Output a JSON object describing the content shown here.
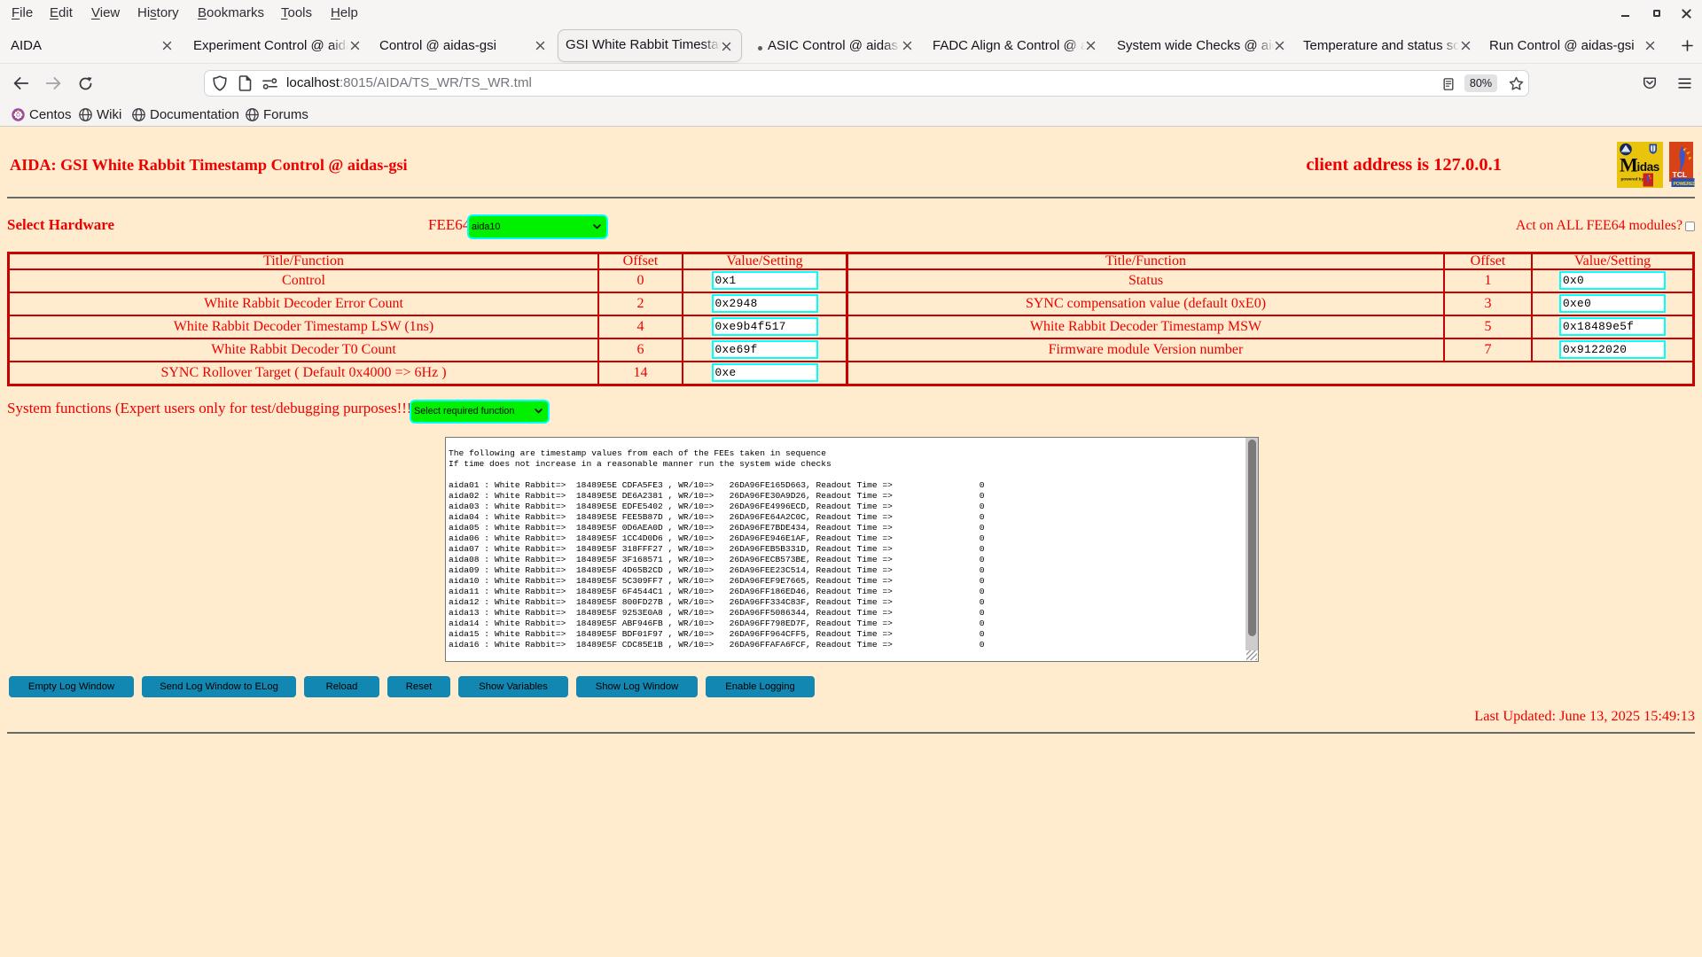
{
  "window": {
    "menus": [
      {
        "pre": "",
        "key": "F",
        "post": "ile"
      },
      {
        "pre": "",
        "key": "E",
        "post": "dit"
      },
      {
        "pre": "",
        "key": "V",
        "post": "iew"
      },
      {
        "pre": "Hi",
        "key": "s",
        "post": "tory"
      },
      {
        "pre": "",
        "key": "B",
        "post": "ookmarks"
      },
      {
        "pre": "",
        "key": "T",
        "post": "ools"
      },
      {
        "pre": "",
        "key": "H",
        "post": "elp"
      }
    ]
  },
  "tabs": [
    {
      "title": "AIDA",
      "active": false
    },
    {
      "title": "Experiment Control @ aidas",
      "active": false
    },
    {
      "title": "Control @ aidas-gsi",
      "active": false
    },
    {
      "title": "GSI White Rabbit Timestamp",
      "active": true
    },
    {
      "title": "ASIC Control @ aidas-gs",
      "active": false,
      "dot": true
    },
    {
      "title": "FADC Align & Control @ aid",
      "active": false
    },
    {
      "title": "System wide Checks @ aida",
      "active": false
    },
    {
      "title": "Temperature and status scan",
      "active": false
    },
    {
      "title": "Run Control @ aidas-gsi",
      "active": false
    }
  ],
  "navbar": {
    "url_host": "localhost",
    "url_path": ":8015/AIDA/TS_WR/TS_WR.tml",
    "zoom": "80%"
  },
  "bookmarks": [
    {
      "label": "Centos"
    },
    {
      "label": "Wiki"
    },
    {
      "label": "Documentation"
    },
    {
      "label": "Forums"
    }
  ],
  "page": {
    "title": "AIDA: GSI White Rabbit Timestamp Control @ aidas-gsi",
    "client_address": "client address is 127.0.0.1",
    "select_hardware_label": "Select Hardware",
    "fee64_label": "FEE64",
    "fee64_value": "aida10",
    "act_on_all_label": "Act on ALL FEE64 modules?",
    "table": {
      "headers": [
        "Title/Function",
        "Offset",
        "Value/Setting"
      ],
      "left_rows": [
        {
          "title": "Control",
          "offset": "0",
          "value": "0x1"
        },
        {
          "title": "White Rabbit Decoder Error Count",
          "offset": "2",
          "value": "0x2948"
        },
        {
          "title": "White Rabbit Decoder Timestamp LSW (1ns)",
          "offset": "4",
          "value": "0xe9b4f517"
        },
        {
          "title": "White Rabbit Decoder T0 Count",
          "offset": "6",
          "value": "0xe69f"
        },
        {
          "title": "SYNC Rollover Target ( Default 0x4000 => 6Hz )",
          "offset": "14",
          "value": "0xe"
        }
      ],
      "right_rows": [
        {
          "title": "Status",
          "offset": "1",
          "value": "0x0"
        },
        {
          "title": "SYNC compensation value (default 0xE0)",
          "offset": "3",
          "value": "0xe0"
        },
        {
          "title": "White Rabbit Decoder Timestamp MSW",
          "offset": "5",
          "value": "0x18489e5f"
        },
        {
          "title": "Firmware module Version number",
          "offset": "7",
          "value": "0x9122020"
        }
      ]
    },
    "system_functions_label": "System functions (Expert users only for test/debugging purposes!!!)",
    "system_functions_value": "Select required function",
    "log_text": "The following are timestamp values from each of the FEEs taken in sequence\nIf time does not increase in a reasonable manner run the system wide checks\n\naida01 : White Rabbit=>  18489E5E CDFA5FE3 , WR/10=>   26DA96FE165D663, Readout Time =>                 0\naida02 : White Rabbit=>  18489E5E DE6A2381 , WR/10=>   26DA96FE30A9D26, Readout Time =>                 0\naida03 : White Rabbit=>  18489E5E EDFE5402 , WR/10=>   26DA96FE4996ECD, Readout Time =>                 0\naida04 : White Rabbit=>  18489E5E FEE5B87D , WR/10=>   26DA96FE64A2C0C, Readout Time =>                 0\naida05 : White Rabbit=>  18489E5F 0D6AEA0D , WR/10=>   26DA96FE7BDE434, Readout Time =>                 0\naida06 : White Rabbit=>  18489E5F 1CC4D0D6 , WR/10=>   26DA96FE946E1AF, Readout Time =>                 0\naida07 : White Rabbit=>  18489E5F 318FFF27 , WR/10=>   26DA96FEB5B331D, Readout Time =>                 0\naida08 : White Rabbit=>  18489E5F 3F168571 , WR/10=>   26DA96FECB573BE, Readout Time =>                 0\naida09 : White Rabbit=>  18489E5F 4D65B2CD , WR/10=>   26DA96FEE23C514, Readout Time =>                 0\naida10 : White Rabbit=>  18489E5F 5C309FF7 , WR/10=>   26DA96FEF9E7665, Readout Time =>                 0\naida11 : White Rabbit=>  18489E5F 6F4544C1 , WR/10=>   26DA96FF186ED46, Readout Time =>                 0\naida12 : White Rabbit=>  18489E5F 800FD27B , WR/10=>   26DA96FF334C83F, Readout Time =>                 0\naida13 : White Rabbit=>  18489E5F 9253E0A8 , WR/10=>   26DA96FF5086344, Readout Time =>                 0\naida14 : White Rabbit=>  18489E5F ABF946FB , WR/10=>   26DA96FF798ED7F, Readout Time =>                 0\naida15 : White Rabbit=>  18489E5F BDF01F97 , WR/10=>   26DA96FF964CFF5, Readout Time =>                 0\naida16 : White Rabbit=>  18489E5F CDC85E1B , WR/10=>   26DA96FFAFA6FCF, Readout Time =>                 0",
    "buttons": [
      "Empty Log Window",
      "Send Log Window to ELog",
      "Reload",
      "Reset",
      "Show Variables",
      "Show Log Window",
      "Enable Logging"
    ],
    "last_updated": "Last Updated: June 13, 2025 15:49:13"
  },
  "colors": {
    "page_background": "#ffebcd",
    "text_red": "#ee0000",
    "table_border_red": "#c80000",
    "select_green": "#00f000",
    "input_border_cyan": "#00ffff",
    "button_blue": "#1389b5"
  }
}
